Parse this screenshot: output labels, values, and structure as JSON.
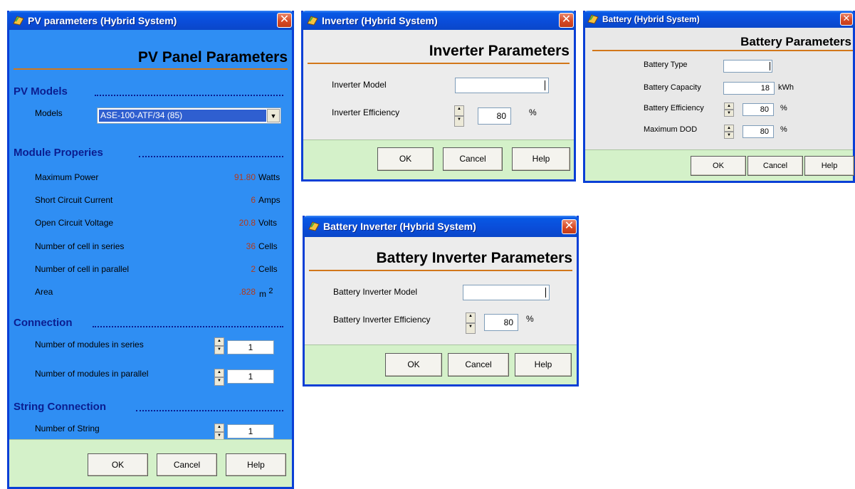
{
  "pv_window": {
    "title": "PV parameters (Hybrid System)",
    "header": "PV Panel Parameters",
    "models_section": "PV Models",
    "models_label": "Models",
    "models_selected": "ASE-100-ATF/34 (85)",
    "module_section": "Module Properies",
    "properties": [
      {
        "label": "Maximum Power",
        "value": "91.80",
        "unit": "Watts"
      },
      {
        "label": "Short Circuit Current",
        "value": "6",
        "unit": "Amps"
      },
      {
        "label": "Open Circuit Voltage",
        "value": "20.8",
        "unit": "Volts"
      },
      {
        "label": "Number of cell in series",
        "value": "36",
        "unit": "Cells"
      },
      {
        "label": "Number of cell in parallel",
        "value": "2",
        "unit": "Cells"
      },
      {
        "label": "Area",
        "value": ".828",
        "unit": "m",
        "unit_sup": "2"
      }
    ],
    "connection_section": "Connection",
    "series_label": "Number of modules in series",
    "series_value": "1",
    "parallel_label": "Number of modules in parallel",
    "parallel_value": "1",
    "string_section": "String Connection",
    "string_label": "Number of String",
    "string_value": "1",
    "ok": "OK",
    "cancel": "Cancel",
    "help": "Help"
  },
  "inverter_window": {
    "title": "Inverter (Hybrid System)",
    "header": "Inverter Parameters",
    "model_label": "Inverter Model",
    "model_value": "",
    "efficiency_label": "Inverter Efficiency",
    "efficiency_value": "80",
    "efficiency_unit": "%",
    "ok": "OK",
    "cancel": "Cancel",
    "help": "Help"
  },
  "battery_window": {
    "title": "Battery (Hybrid System)",
    "header": "Battery Parameters",
    "type_label": "Battery Type",
    "type_value": "",
    "capacity_label": "Battery Capacity",
    "capacity_value": "18",
    "capacity_unit": "kWh",
    "efficiency_label": "Battery Efficiency",
    "efficiency_value": "80",
    "efficiency_unit": "%",
    "dod_label": "Maximum DOD",
    "dod_value": "80",
    "dod_unit": "%",
    "ok": "OK",
    "cancel": "Cancel",
    "help": "Help"
  },
  "battery_inverter_window": {
    "title": "Battery Inverter  (Hybrid System)",
    "header": "Battery Inverter Parameters",
    "model_label": "Battery Inverter Model",
    "model_value": "",
    "efficiency_label": "Battery Inverter Efficiency",
    "efficiency_value": "80",
    "efficiency_unit": "%",
    "ok": "OK",
    "cancel": "Cancel",
    "help": "Help"
  },
  "icons": {
    "app": "app-icon",
    "close": "close-icon",
    "spin_up": "spin-up-icon",
    "spin_down": "spin-down-icon",
    "dropdown": "dropdown-arrow-icon"
  },
  "colors": {
    "titlebar": "#0a4cd8",
    "pv_background": "#2f8ef3",
    "section_text": "#0b1d8f",
    "value_text": "#b23a1c",
    "footer": "#d4f1c9",
    "header_rule": "#d2771a"
  }
}
